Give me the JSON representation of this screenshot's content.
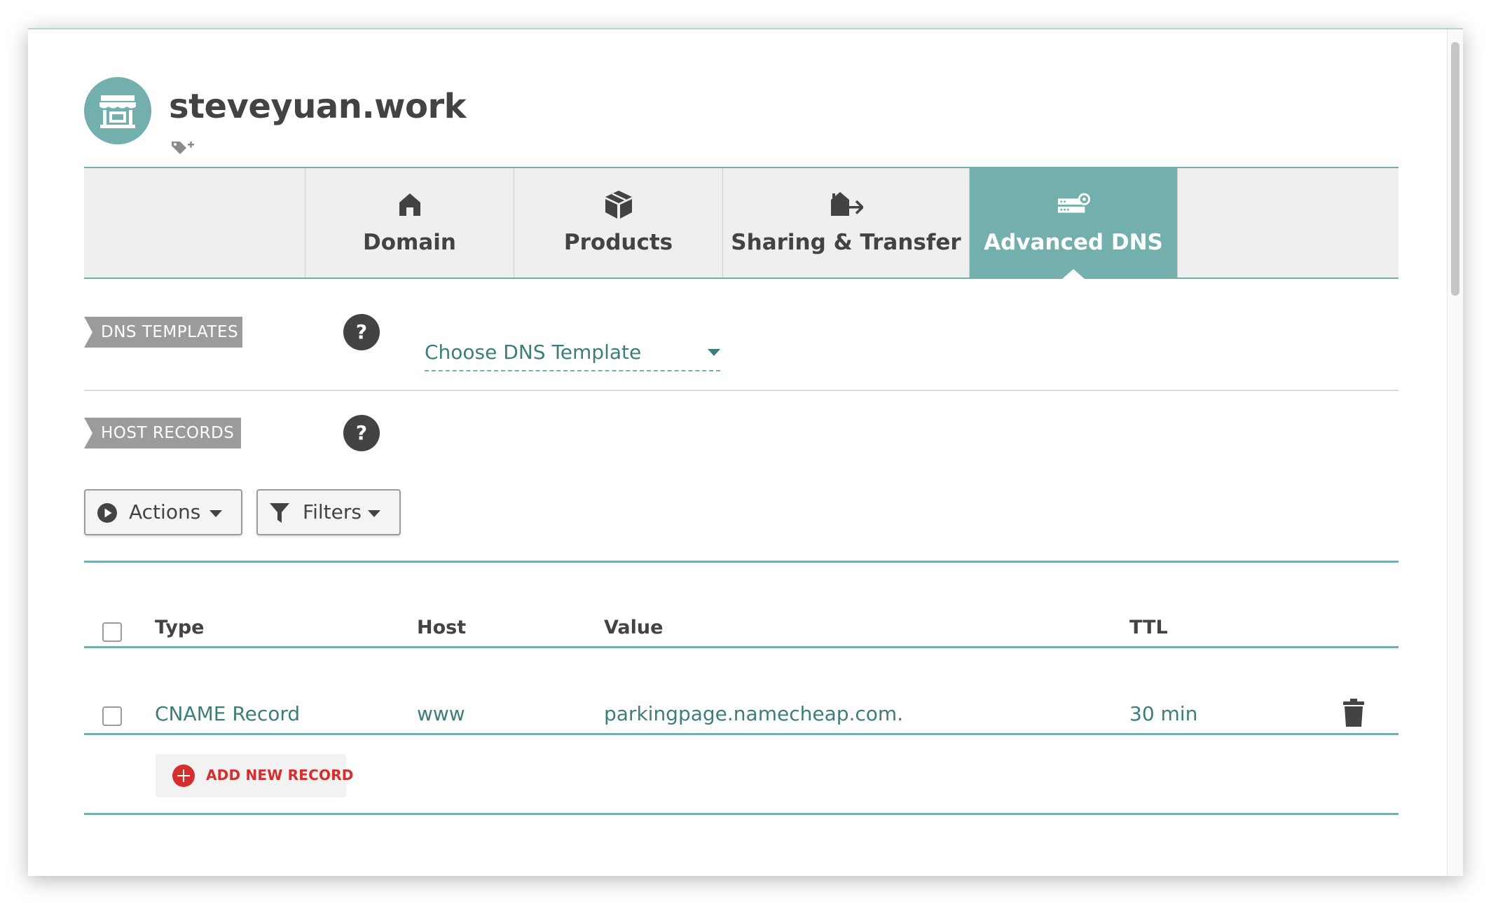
{
  "domain": {
    "name": "steveyuan.work"
  },
  "tabs": [
    {
      "label": "Domain",
      "icon": "home-icon"
    },
    {
      "label": "Products",
      "icon": "box-icon"
    },
    {
      "label": "Sharing & Transfer",
      "icon": "house-transfer-icon"
    },
    {
      "label": "Advanced DNS",
      "icon": "dns-server-icon",
      "active": true
    }
  ],
  "dns_templates": {
    "tag": "DNS TEMPLATES",
    "help": "?",
    "select_value": "Choose DNS Template"
  },
  "host_records": {
    "tag": "HOST RECORDS",
    "help": "?",
    "actions_label": "Actions",
    "filters_label": "Filters",
    "columns": {
      "type": "Type",
      "host": "Host",
      "value": "Value",
      "ttl": "TTL"
    },
    "rows": [
      {
        "type": "CNAME Record",
        "host": "www",
        "value": "parkingpage.namecheap.com.",
        "ttl": "30 min"
      }
    ],
    "add_label": "ADD NEW RECORD"
  },
  "colors": {
    "accent": "#73b0ad",
    "text": "#434343",
    "link": "#3d7d7a",
    "danger": "#d62d2d",
    "tag": "#9b9b9b"
  }
}
